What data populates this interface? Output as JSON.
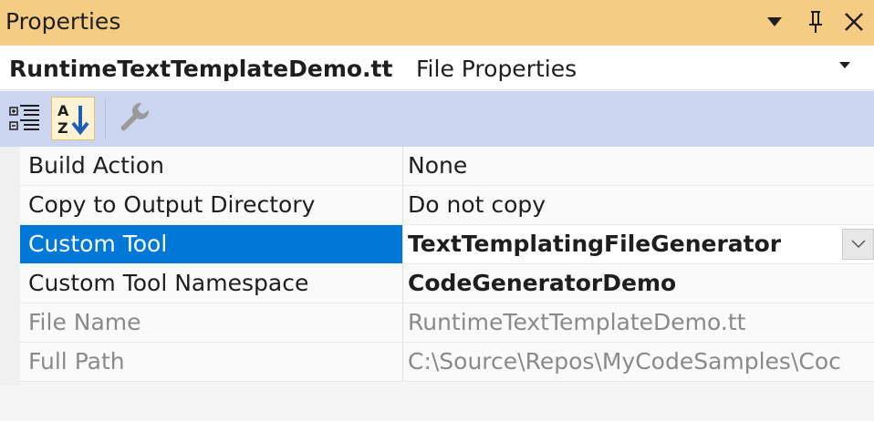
{
  "window": {
    "title": "Properties",
    "icons": [
      "chevron-down-icon",
      "pin-icon",
      "close-icon"
    ]
  },
  "object_selector": {
    "name": "RuntimeTextTemplateDemo.tt",
    "type": "File Properties"
  },
  "toolbar": {
    "tools": [
      "categorized-icon",
      "alphabetical-icon",
      "property-pages-icon"
    ],
    "active_tool": "alphabetical-icon"
  },
  "properties": [
    {
      "name": "Build Action",
      "value": "None",
      "state": "normal"
    },
    {
      "name": "Copy to Output Directory",
      "value": "Do not copy",
      "state": "normal"
    },
    {
      "name": "Custom Tool",
      "value": "TextTemplatingFileGenerator",
      "state": "selected-bold"
    },
    {
      "name": "Custom Tool Namespace",
      "value": "CodeGeneratorDemo",
      "state": "bold"
    },
    {
      "name": "File Name",
      "value": "RuntimeTextTemplateDemo.tt",
      "state": "disabled"
    },
    {
      "name": "Full Path",
      "value": "C:\\Source\\Repos\\MyCodeSamples\\Coc",
      "state": "disabled"
    }
  ],
  "colors": {
    "title_bar": "#f5cc84",
    "toolbar": "#ccd5f0",
    "selection": "#0078d7",
    "disabled_text": "#8a8a8a"
  }
}
